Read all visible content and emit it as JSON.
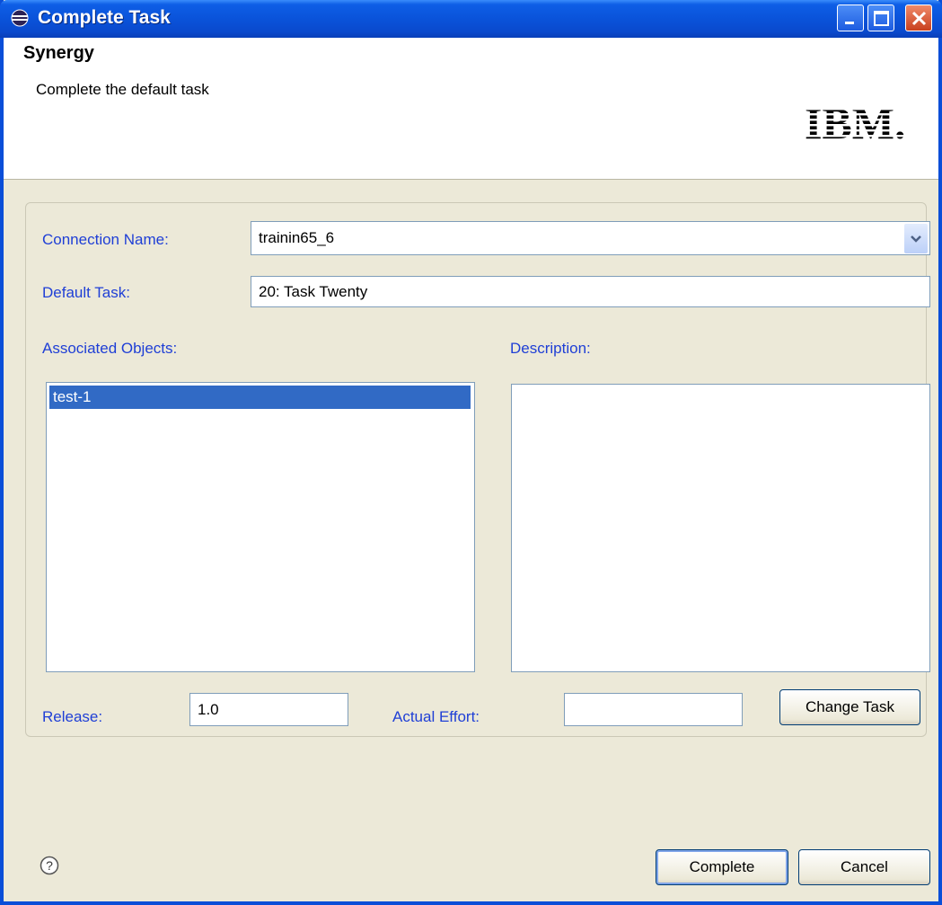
{
  "window": {
    "title": "Complete Task"
  },
  "banner": {
    "title": "Synergy",
    "subtitle": "Complete the default task",
    "logo": "IBM."
  },
  "form": {
    "connection_name_label": "Connection Name:",
    "connection_name_value": "trainin65_6",
    "default_task_label": "Default Task:",
    "default_task_value": "20: Task Twenty",
    "associated_objects_label": "Associated Objects:",
    "associated_objects": [
      "test-1"
    ],
    "description_label": "Description:",
    "description_value": "",
    "release_label": "Release:",
    "release_value": "1.0",
    "actual_effort_label": "Actual Effort:",
    "actual_effort_value": "",
    "change_task_label": "Change Task"
  },
  "footer": {
    "complete_label": "Complete",
    "cancel_label": "Cancel"
  },
  "icons": {
    "title": "eclipse-icon",
    "help": "help-icon",
    "combo": "chevron-down-icon"
  },
  "colors": {
    "titlebar": "#0a53da",
    "label": "#1f3fd6",
    "selection": "#316ac5",
    "dialog_bg": "#ece9d8"
  }
}
